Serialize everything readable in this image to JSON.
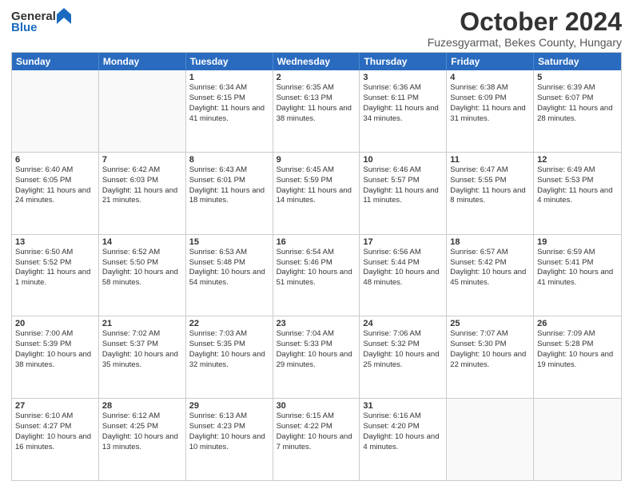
{
  "logo": {
    "general": "General",
    "blue": "Blue"
  },
  "header": {
    "title": "October 2024",
    "subtitle": "Fuzesgyarmat, Bekes County, Hungary"
  },
  "days": [
    "Sunday",
    "Monday",
    "Tuesday",
    "Wednesday",
    "Thursday",
    "Friday",
    "Saturday"
  ],
  "weeks": [
    [
      {
        "day": "",
        "empty": true
      },
      {
        "day": "",
        "empty": true
      },
      {
        "num": "1",
        "sunrise": "Sunrise: 6:34 AM",
        "sunset": "Sunset: 6:15 PM",
        "daylight": "Daylight: 11 hours and 41 minutes."
      },
      {
        "num": "2",
        "sunrise": "Sunrise: 6:35 AM",
        "sunset": "Sunset: 6:13 PM",
        "daylight": "Daylight: 11 hours and 38 minutes."
      },
      {
        "num": "3",
        "sunrise": "Sunrise: 6:36 AM",
        "sunset": "Sunset: 6:11 PM",
        "daylight": "Daylight: 11 hours and 34 minutes."
      },
      {
        "num": "4",
        "sunrise": "Sunrise: 6:38 AM",
        "sunset": "Sunset: 6:09 PM",
        "daylight": "Daylight: 11 hours and 31 minutes."
      },
      {
        "num": "5",
        "sunrise": "Sunrise: 6:39 AM",
        "sunset": "Sunset: 6:07 PM",
        "daylight": "Daylight: 11 hours and 28 minutes."
      }
    ],
    [
      {
        "num": "6",
        "sunrise": "Sunrise: 6:40 AM",
        "sunset": "Sunset: 6:05 PM",
        "daylight": "Daylight: 11 hours and 24 minutes."
      },
      {
        "num": "7",
        "sunrise": "Sunrise: 6:42 AM",
        "sunset": "Sunset: 6:03 PM",
        "daylight": "Daylight: 11 hours and 21 minutes."
      },
      {
        "num": "8",
        "sunrise": "Sunrise: 6:43 AM",
        "sunset": "Sunset: 6:01 PM",
        "daylight": "Daylight: 11 hours and 18 minutes."
      },
      {
        "num": "9",
        "sunrise": "Sunrise: 6:45 AM",
        "sunset": "Sunset: 5:59 PM",
        "daylight": "Daylight: 11 hours and 14 minutes."
      },
      {
        "num": "10",
        "sunrise": "Sunrise: 6:46 AM",
        "sunset": "Sunset: 5:57 PM",
        "daylight": "Daylight: 11 hours and 11 minutes."
      },
      {
        "num": "11",
        "sunrise": "Sunrise: 6:47 AM",
        "sunset": "Sunset: 5:55 PM",
        "daylight": "Daylight: 11 hours and 8 minutes."
      },
      {
        "num": "12",
        "sunrise": "Sunrise: 6:49 AM",
        "sunset": "Sunset: 5:53 PM",
        "daylight": "Daylight: 11 hours and 4 minutes."
      }
    ],
    [
      {
        "num": "13",
        "sunrise": "Sunrise: 6:50 AM",
        "sunset": "Sunset: 5:52 PM",
        "daylight": "Daylight: 11 hours and 1 minute."
      },
      {
        "num": "14",
        "sunrise": "Sunrise: 6:52 AM",
        "sunset": "Sunset: 5:50 PM",
        "daylight": "Daylight: 10 hours and 58 minutes."
      },
      {
        "num": "15",
        "sunrise": "Sunrise: 6:53 AM",
        "sunset": "Sunset: 5:48 PM",
        "daylight": "Daylight: 10 hours and 54 minutes."
      },
      {
        "num": "16",
        "sunrise": "Sunrise: 6:54 AM",
        "sunset": "Sunset: 5:46 PM",
        "daylight": "Daylight: 10 hours and 51 minutes."
      },
      {
        "num": "17",
        "sunrise": "Sunrise: 6:56 AM",
        "sunset": "Sunset: 5:44 PM",
        "daylight": "Daylight: 10 hours and 48 minutes."
      },
      {
        "num": "18",
        "sunrise": "Sunrise: 6:57 AM",
        "sunset": "Sunset: 5:42 PM",
        "daylight": "Daylight: 10 hours and 45 minutes."
      },
      {
        "num": "19",
        "sunrise": "Sunrise: 6:59 AM",
        "sunset": "Sunset: 5:41 PM",
        "daylight": "Daylight: 10 hours and 41 minutes."
      }
    ],
    [
      {
        "num": "20",
        "sunrise": "Sunrise: 7:00 AM",
        "sunset": "Sunset: 5:39 PM",
        "daylight": "Daylight: 10 hours and 38 minutes."
      },
      {
        "num": "21",
        "sunrise": "Sunrise: 7:02 AM",
        "sunset": "Sunset: 5:37 PM",
        "daylight": "Daylight: 10 hours and 35 minutes."
      },
      {
        "num": "22",
        "sunrise": "Sunrise: 7:03 AM",
        "sunset": "Sunset: 5:35 PM",
        "daylight": "Daylight: 10 hours and 32 minutes."
      },
      {
        "num": "23",
        "sunrise": "Sunrise: 7:04 AM",
        "sunset": "Sunset: 5:33 PM",
        "daylight": "Daylight: 10 hours and 29 minutes."
      },
      {
        "num": "24",
        "sunrise": "Sunrise: 7:06 AM",
        "sunset": "Sunset: 5:32 PM",
        "daylight": "Daylight: 10 hours and 25 minutes."
      },
      {
        "num": "25",
        "sunrise": "Sunrise: 7:07 AM",
        "sunset": "Sunset: 5:30 PM",
        "daylight": "Daylight: 10 hours and 22 minutes."
      },
      {
        "num": "26",
        "sunrise": "Sunrise: 7:09 AM",
        "sunset": "Sunset: 5:28 PM",
        "daylight": "Daylight: 10 hours and 19 minutes."
      }
    ],
    [
      {
        "num": "27",
        "sunrise": "Sunrise: 6:10 AM",
        "sunset": "Sunset: 4:27 PM",
        "daylight": "Daylight: 10 hours and 16 minutes."
      },
      {
        "num": "28",
        "sunrise": "Sunrise: 6:12 AM",
        "sunset": "Sunset: 4:25 PM",
        "daylight": "Daylight: 10 hours and 13 minutes."
      },
      {
        "num": "29",
        "sunrise": "Sunrise: 6:13 AM",
        "sunset": "Sunset: 4:23 PM",
        "daylight": "Daylight: 10 hours and 10 minutes."
      },
      {
        "num": "30",
        "sunrise": "Sunrise: 6:15 AM",
        "sunset": "Sunset: 4:22 PM",
        "daylight": "Daylight: 10 hours and 7 minutes."
      },
      {
        "num": "31",
        "sunrise": "Sunrise: 6:16 AM",
        "sunset": "Sunset: 4:20 PM",
        "daylight": "Daylight: 10 hours and 4 minutes."
      },
      {
        "day": "",
        "empty": true
      },
      {
        "day": "",
        "empty": true
      }
    ]
  ]
}
